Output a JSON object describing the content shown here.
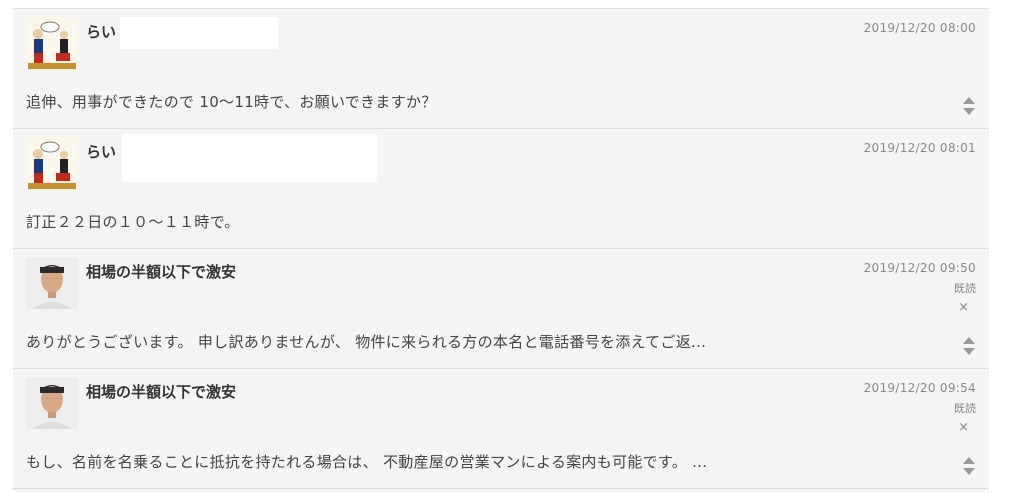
{
  "messages": [
    {
      "sender": "らい",
      "avatar_icon": "popeye-avatar-icon",
      "time": "2019/12/20 08:00",
      "read": "",
      "close": "",
      "body": "追伸、用事ができたので 10～11時で、お願いできますか？"
    },
    {
      "sender": "らい",
      "avatar_icon": "popeye-avatar-icon",
      "time": "2019/12/20 08:01",
      "read": "",
      "close": "",
      "body": "訂正２２日の１０～１１時で。"
    },
    {
      "sender": "相場の半額以下で激安",
      "avatar_icon": "person-photo-avatar-icon",
      "time": "2019/12/20 09:50",
      "read": "既読",
      "close": "×",
      "body": "ありがとうございます。 申し訳ありませんが、 物件に来られる方の本名と電話番号を添えてご返..."
    },
    {
      "sender": "相場の半額以下で激安",
      "avatar_icon": "person-photo-avatar-icon",
      "time": "2019/12/20 09:54",
      "read": "既読",
      "close": "×",
      "body": "もし、名前を名乗ることに抵抗を持たれる場合は、 不動産屋の営業マンによる案内も可能です。 ..."
    }
  ],
  "colors": {
    "background": "#f4f4f4",
    "text": "#444444",
    "meta": "#888888",
    "expand_icon": "#999999"
  }
}
